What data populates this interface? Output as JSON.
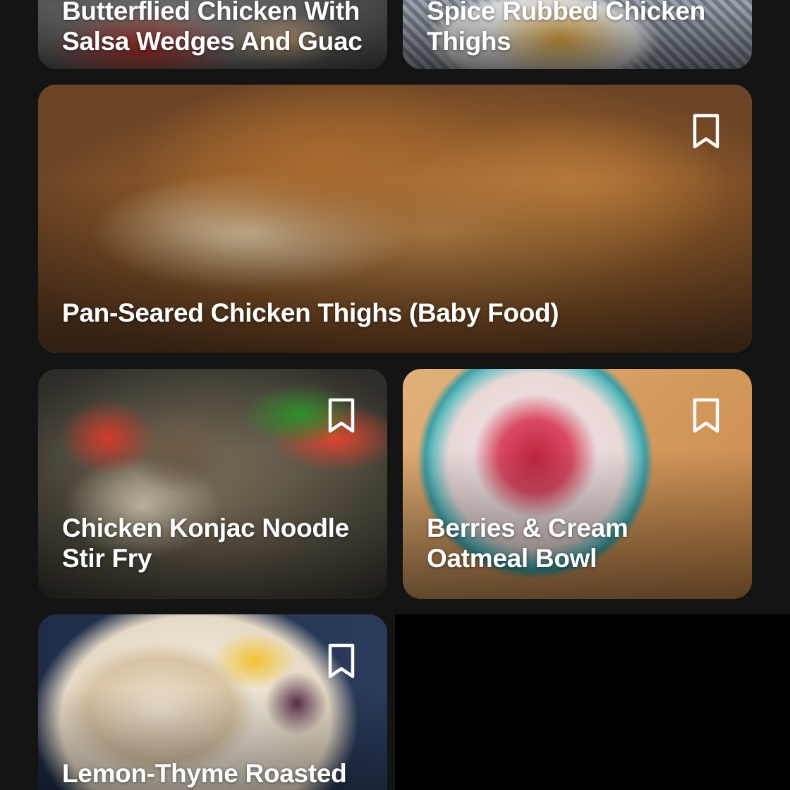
{
  "colors": {
    "background": "#141414",
    "title_text": "#ffffff",
    "bookmark_outline": "#ffffff"
  },
  "recipes": [
    {
      "title_lines": [
        "Butterflied Chicken With",
        "Salsa Wedges And Guac"
      ],
      "bookmark_icon": "bookmark-outline-icon"
    },
    {
      "title_lines": [
        "Spice Rubbed Chicken",
        "Thighs"
      ],
      "bookmark_icon": "bookmark-outline-icon"
    },
    {
      "title_lines": [
        "Pan-Seared Chicken Thighs (Baby Food)"
      ],
      "bookmark_icon": "bookmark-outline-icon"
    },
    {
      "title_lines": [
        "Chicken Konjac Noodle",
        "Stir Fry"
      ],
      "bookmark_icon": "bookmark-outline-icon"
    },
    {
      "title_lines": [
        "Berries & Cream",
        "Oatmeal Bowl"
      ],
      "bookmark_icon": "bookmark-outline-icon"
    },
    {
      "title_lines": [
        "Lemon-Thyme Roasted"
      ],
      "bookmark_icon": "bookmark-outline-icon"
    }
  ]
}
